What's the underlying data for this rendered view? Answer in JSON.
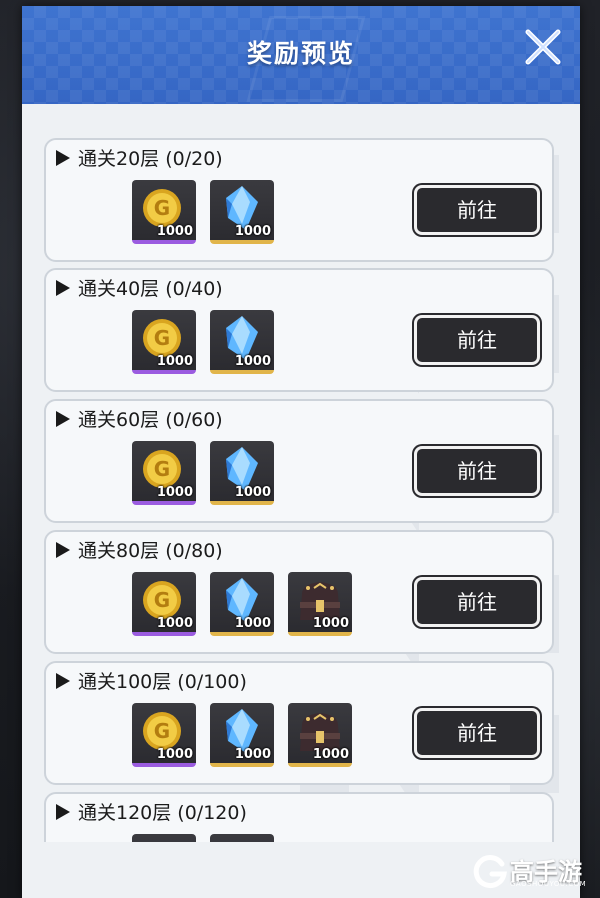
{
  "dialog": {
    "title": "奖励预览",
    "go_label": "前往"
  },
  "rewards": [
    {
      "title": "通关20层 (0/20)",
      "items": [
        {
          "icon": "gold-coin-icon",
          "count": "1000"
        },
        {
          "icon": "blue-crystal-icon",
          "count": "1000"
        }
      ]
    },
    {
      "title": "通关40层 (0/40)",
      "items": [
        {
          "icon": "gold-coin-icon",
          "count": "1000"
        },
        {
          "icon": "blue-crystal-icon",
          "count": "1000"
        }
      ]
    },
    {
      "title": "通关60层 (0/60)",
      "items": [
        {
          "icon": "gold-coin-icon",
          "count": "1000"
        },
        {
          "icon": "blue-crystal-icon",
          "count": "1000"
        }
      ]
    },
    {
      "title": "通关80层 (0/80)",
      "items": [
        {
          "icon": "gold-coin-icon",
          "count": "1000"
        },
        {
          "icon": "blue-crystal-icon",
          "count": "1000"
        },
        {
          "icon": "treasure-bag-icon",
          "count": "1000"
        }
      ]
    },
    {
      "title": "通关100层 (0/100)",
      "items": [
        {
          "icon": "gold-coin-icon",
          "count": "1000"
        },
        {
          "icon": "blue-crystal-icon",
          "count": "1000"
        },
        {
          "icon": "treasure-bag-icon",
          "count": "1000"
        }
      ]
    },
    {
      "title": "通关120层 (0/120)",
      "items": []
    }
  ],
  "brand": {
    "name": "高手游",
    "url": "GAOSHOUYOU.COM"
  },
  "colors": {
    "header_blue": "#3566c4",
    "coin_rarity": "#9b5ce0",
    "crystal_rarity": "#e1b54a"
  }
}
